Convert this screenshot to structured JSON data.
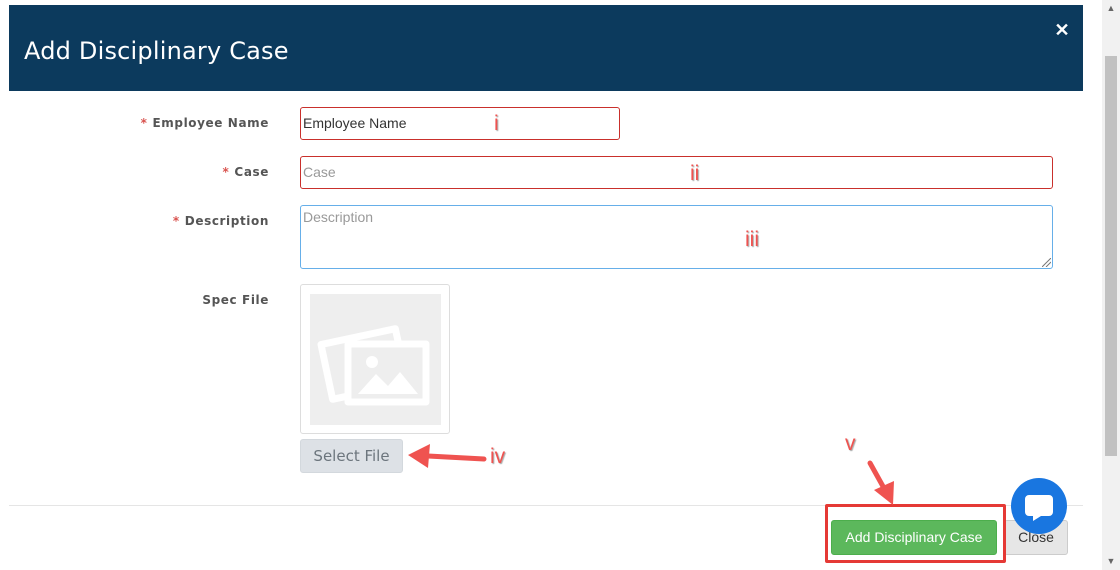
{
  "modal": {
    "title": "Add Disciplinary Case",
    "close_icon": "close-icon"
  },
  "form": {
    "employee_name": {
      "label": "Employee Name",
      "required_mark": "*",
      "value": "Employee Name"
    },
    "case": {
      "label": "Case",
      "required_mark": "*",
      "placeholder": "Case"
    },
    "description": {
      "label": "Description",
      "required_mark": "*",
      "placeholder": "Description"
    },
    "spec_file": {
      "label": "Spec File",
      "placeholder_icon": "image-placeholder-icon",
      "select_label": "Select File"
    }
  },
  "footer": {
    "primary_label": "Add Disciplinary Case",
    "close_label": "Close"
  },
  "chat": {
    "icon": "chat-bubble-icon"
  },
  "annotations": {
    "marker_1": "i",
    "marker_2": "ii",
    "marker_3": "iii",
    "marker_4": "iv",
    "marker_5": "v"
  },
  "colors": {
    "header_bg": "#0c3a5d",
    "required": "#d9534f",
    "primary": "#5cb85c",
    "annotation": "#ef5350",
    "chat": "#1976e0"
  }
}
